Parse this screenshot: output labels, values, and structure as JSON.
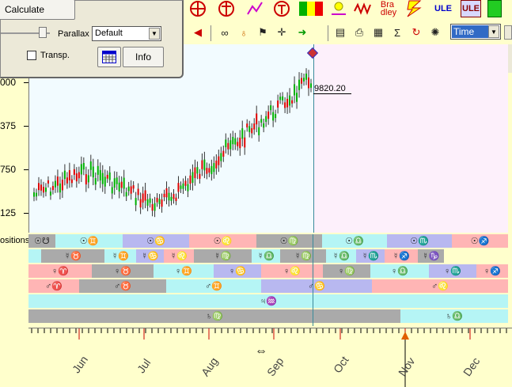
{
  "panel": {
    "calculate_label": "Calculate",
    "parallax_label": "Parallax",
    "parallax_value": "Default",
    "transp_label": "Transp.",
    "info_label": "Info"
  },
  "toolbar": {
    "bradley_label": "Bra\ndley",
    "ule_label": "ULE",
    "ule2_label": "ULE",
    "time_select_value": "Time"
  },
  "chart": {
    "y_ticks": [
      "000",
      "375",
      "750",
      "125"
    ],
    "price_label": "9820.20",
    "positions_label": "ositions"
  },
  "chart_data": {
    "type": "candlestick",
    "last_value": 9820.2,
    "x_months": [
      "Jun",
      "Jul",
      "Aug",
      "Sep",
      "Oct",
      "Nov",
      "Dec"
    ]
  },
  "strip": {
    "rows": [
      [
        {
          "label": "☉☋",
          "color": "#aaaaaa"
        },
        {
          "label": "☉♊",
          "color": "#b5f5f5"
        },
        {
          "label": "☉♋",
          "color": "#b8b8f0"
        },
        {
          "label": "☉♌",
          "color": "#ffb5b5"
        },
        {
          "label": "☉♍",
          "color": "#aaaaaa"
        },
        {
          "label": "☉♎",
          "color": "#b5f5f5"
        },
        {
          "label": "☉♏",
          "color": "#b8b8f0"
        },
        {
          "label": "☉♐",
          "color": "#ffb5b5"
        }
      ],
      [
        {
          "label": "",
          "color": "#b5f5f5"
        },
        {
          "label": "☿♉",
          "color": "#aaaaaa"
        },
        {
          "label": "☿♊",
          "color": "#b5f5f5"
        },
        {
          "label": "☿♋",
          "color": "#b8b8f0"
        },
        {
          "label": "☿♌",
          "color": "#ffb5b5"
        },
        {
          "label": "☿♍",
          "color": "#aaaaaa"
        },
        {
          "label": "☿♎",
          "color": "#b5f5f5"
        },
        {
          "label": "☿♍",
          "color": "#aaaaaa"
        },
        {
          "label": "☿♎",
          "color": "#b5f5f5"
        },
        {
          "label": "☿♏",
          "color": "#b8b8f0"
        },
        {
          "label": "☿♐",
          "color": "#ffb5b5"
        },
        {
          "label": "☿♑",
          "color": "#aaaaaa"
        }
      ],
      [
        {
          "label": "♀♈",
          "color": "#ffb5b5"
        },
        {
          "label": "♀♉",
          "color": "#aaaaaa"
        },
        {
          "label": "♀♊",
          "color": "#b5f5f5"
        },
        {
          "label": "♀♋",
          "color": "#b8b8f0"
        },
        {
          "label": "♀♌",
          "color": "#ffb5b5"
        },
        {
          "label": "♀♍",
          "color": "#aaaaaa"
        },
        {
          "label": "♀♎",
          "color": "#b5f5f5"
        },
        {
          "label": "♀♏",
          "color": "#b8b8f0"
        },
        {
          "label": "♀♐",
          "color": "#ffb5b5"
        }
      ],
      [
        {
          "label": "♂♈",
          "color": "#ffb5b5"
        },
        {
          "label": "♂♉",
          "color": "#aaaaaa"
        },
        {
          "label": "♂♊",
          "color": "#b5f5f5"
        },
        {
          "label": "♂♋",
          "color": "#b8b8f0"
        },
        {
          "label": "♂♌",
          "color": "#ffb5b5"
        }
      ],
      [
        {
          "label": "♃♒",
          "color": "#b5f5f5"
        }
      ],
      [
        {
          "label": "♄♍",
          "color": "#aaaaaa"
        },
        {
          "label": "♄♎",
          "color": "#b5f5f5"
        }
      ]
    ]
  },
  "timeaxis": {
    "months": [
      "Jun",
      "Jul",
      "Aug",
      "Sep",
      "Oct",
      "Nov",
      "Dec"
    ]
  }
}
